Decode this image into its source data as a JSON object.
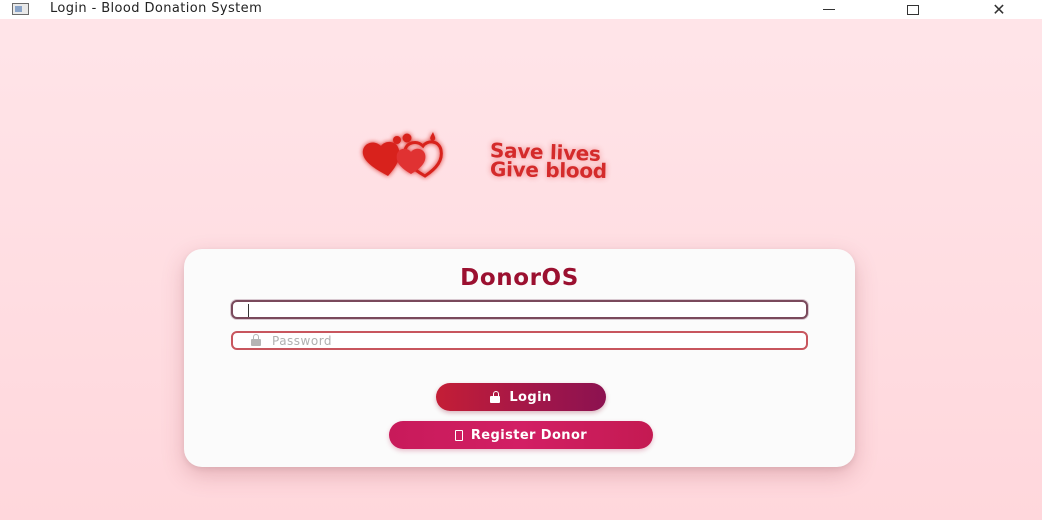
{
  "window": {
    "title": "Login - Blood Donation System"
  },
  "logo": {
    "line1": "Save lives",
    "line2": "Give blood",
    "color": "#d42b2b"
  },
  "card": {
    "title": "DonorOS",
    "username_field": {
      "value": "",
      "placeholder": ""
    },
    "password_field": {
      "value": "",
      "placeholder": "Password"
    },
    "login_button": "Login",
    "register_button": "Register Donor"
  },
  "colors": {
    "accent": "#9b1030",
    "login_button": "#b41a40",
    "register_button": "#d21f64",
    "background": "#ffdde2"
  },
  "icons": {
    "app": "window-icon",
    "password": "lock-icon",
    "login": "unlock-icon",
    "register": "box-icon"
  }
}
